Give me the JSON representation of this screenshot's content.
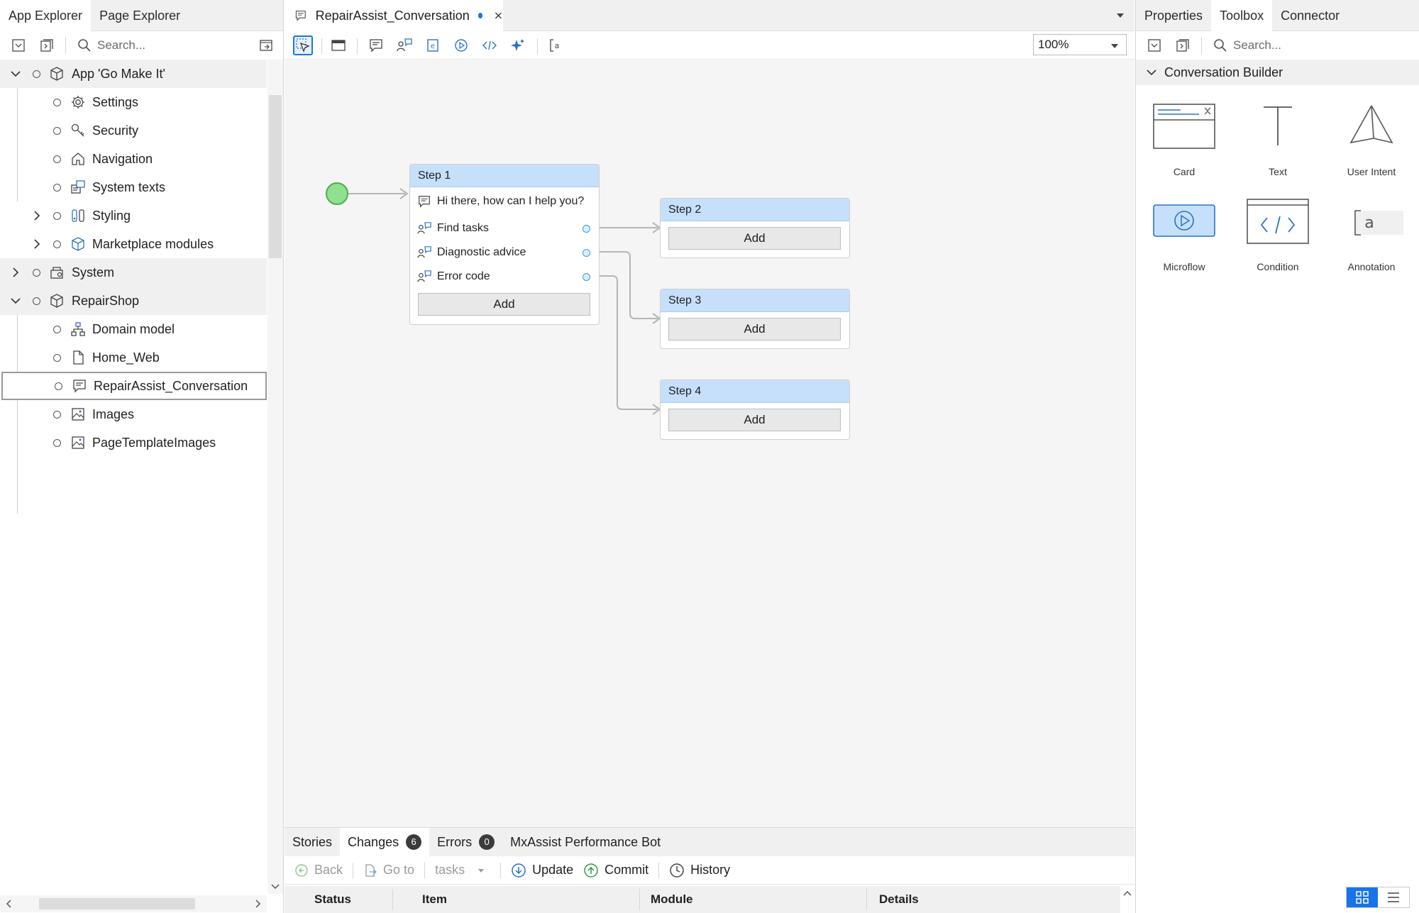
{
  "left_panel": {
    "tabs": [
      "App Explorer",
      "Page Explorer"
    ],
    "search_placeholder": "Search...",
    "tree": [
      {
        "label": "App 'Go Make It'",
        "icon": "app-cube-icon"
      },
      {
        "label": "Settings",
        "icon": "gear-icon"
      },
      {
        "label": "Security",
        "icon": "key-icon"
      },
      {
        "label": "Navigation",
        "icon": "home-icon"
      },
      {
        "label": "System texts",
        "icon": "system-texts-icon"
      },
      {
        "label": "Styling",
        "icon": "styling-icon"
      },
      {
        "label": "Marketplace modules",
        "icon": "marketplace-icon"
      },
      {
        "label": "System",
        "icon": "system-module-icon"
      },
      {
        "label": "RepairShop",
        "icon": "module-icon"
      },
      {
        "label": "Domain model",
        "icon": "domain-model-icon"
      },
      {
        "label": "Home_Web",
        "icon": "page-icon"
      },
      {
        "label": "RepairAssist_Conversation",
        "icon": "conversation-icon"
      },
      {
        "label": "Images",
        "icon": "image-icon"
      },
      {
        "label": "PageTemplateImages",
        "icon": "image-icon"
      }
    ]
  },
  "editor": {
    "tab_title": "RepairAssist_Conversation",
    "zoom": "100%",
    "steps": {
      "step1": {
        "title": "Step 1",
        "message": "Hi there, how can I help you?",
        "intents": [
          "Find tasks",
          "Diagnostic advice",
          "Error code"
        ],
        "add_label": "Add"
      },
      "step2": {
        "title": "Step 2",
        "add_label": "Add"
      },
      "step3": {
        "title": "Step 3",
        "add_label": "Add"
      },
      "step4": {
        "title": "Step 4",
        "add_label": "Add"
      }
    }
  },
  "bottom_panel": {
    "tabs": [
      {
        "label": "Stories"
      },
      {
        "label": "Changes",
        "badge": "6"
      },
      {
        "label": "Errors",
        "badge": "0"
      },
      {
        "label": "MxAssist Performance Bot"
      }
    ],
    "toolbar": {
      "back": "Back",
      "goto": "Go to",
      "tasks": "tasks",
      "update": "Update",
      "commit": "Commit",
      "history": "History"
    },
    "columns": [
      "Status",
      "Item",
      "Module",
      "Details"
    ]
  },
  "right_panel": {
    "tabs": [
      "Properties",
      "Toolbox",
      "Connector"
    ],
    "search_placeholder": "Search...",
    "section": "Conversation Builder",
    "tools": [
      "Card",
      "Text",
      "User Intent",
      "Microflow",
      "Condition",
      "Annotation"
    ]
  },
  "colors": {
    "accent": "#1a73e8",
    "step_header": "#c6e0fb",
    "start_node": "#8fe08f"
  }
}
